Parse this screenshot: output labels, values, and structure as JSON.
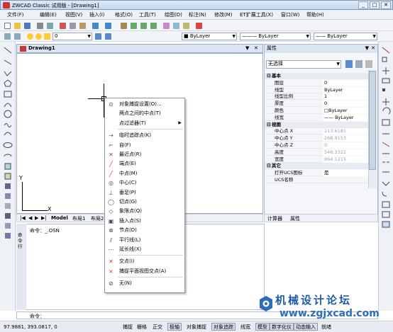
{
  "window": {
    "title": "ZWCAD Classic 试用版 - [Drawing1]"
  },
  "menubar": {
    "items": [
      "文件(F)",
      "编辑(E)",
      "视图(V)",
      "插入(I)",
      "格式(O)",
      "工具(T)",
      "绘图(D)",
      "标注(N)",
      "修改(M)",
      "ET扩展工具(X)",
      "窗口(W)",
      "帮助(H)"
    ]
  },
  "toolbar": {
    "layer_combo": "ByLayer",
    "linetype_combo": "ByLayer",
    "lineweight_combo": "ByLayer",
    "plotstyle_combo": "ByLayer",
    "layer_name": "0"
  },
  "document": {
    "tab_title": "Drawing1"
  },
  "ucs": {
    "x_label": "X",
    "y_label": "Y"
  },
  "layout_tabs": [
    "Model",
    "布局1",
    "布局2"
  ],
  "context_menu": {
    "items": [
      {
        "label": "对象捕捉设置(O)...",
        "icon": "snap-settings-icon"
      },
      {
        "label": "两点之间的中点(T)",
        "icon": "none"
      },
      {
        "label": "点过滤器(T)",
        "icon": "none",
        "submenu": true
      },
      {
        "label": "临时追踪点(K)",
        "icon": "temp-track-icon"
      },
      {
        "label": "自(F)",
        "icon": "from-icon"
      },
      {
        "label": "最近点(R)",
        "icon": "nearest-icon"
      },
      {
        "label": "端点(E)",
        "icon": "endpoint-icon"
      },
      {
        "label": "中点(M)",
        "icon": "midpoint-icon"
      },
      {
        "label": "中心(C)",
        "icon": "center-icon"
      },
      {
        "label": "垂足(P)",
        "icon": "perpendicular-icon"
      },
      {
        "label": "切点(G)",
        "icon": "tangent-icon"
      },
      {
        "label": "象限点(Q)",
        "icon": "quadrant-icon"
      },
      {
        "label": "插入点(S)",
        "icon": "insert-icon"
      },
      {
        "label": "节点(D)",
        "icon": "node-icon"
      },
      {
        "label": "平行线(L)",
        "icon": "parallel-icon"
      },
      {
        "label": "延长线(X)",
        "icon": "extension-icon"
      },
      {
        "label": "交点(I)",
        "icon": "intersection-icon"
      },
      {
        "label": "捕捉平面视图交点(A)",
        "icon": "apparent-intersection-icon"
      },
      {
        "label": "无(N)",
        "icon": "none-snap-icon"
      }
    ]
  },
  "properties": {
    "panel_title": "属性",
    "selection": "无选择",
    "rows": [
      {
        "key": "基本",
        "cat": true
      },
      {
        "key": "图层",
        "value": "0"
      },
      {
        "key": "线型",
        "value": "ByLayer"
      },
      {
        "key": "线型比例",
        "value": "1"
      },
      {
        "key": "厚度",
        "value": "0"
      },
      {
        "key": "颜色",
        "value": "□ByLayer"
      },
      {
        "key": "线宽",
        "value": "—— ByLayer"
      },
      {
        "key": "视图",
        "cat": true
      },
      {
        "key": "中心点 X",
        "value": "213.6181",
        "dim": true
      },
      {
        "key": "中心点 Y",
        "value": "268.9153",
        "dim": true
      },
      {
        "key": "中心点 Z",
        "value": "0",
        "dim": true
      },
      {
        "key": "高度",
        "value": "546.3322",
        "dim": true
      },
      {
        "key": "宽度",
        "value": "864.1215",
        "dim": true
      },
      {
        "key": "其它",
        "cat": true
      },
      {
        "key": "打开UCS图标",
        "value": "是"
      },
      {
        "key": "UCS名称",
        "value": ""
      }
    ],
    "tabs": [
      "计算器",
      "属性"
    ]
  },
  "command": {
    "side_label": "命令行",
    "line1": "命令：_.OSN",
    "line2": "命令："
  },
  "statusbar": {
    "coords": "97.9881,  393.0817,  0",
    "toggles": [
      {
        "label": "捕捉",
        "on": false
      },
      {
        "label": "栅格",
        "on": false
      },
      {
        "label": "正交",
        "on": false
      },
      {
        "label": "极轴",
        "on": true
      },
      {
        "label": "对象捕捉",
        "on": false
      },
      {
        "label": "对象追踪",
        "on": true
      },
      {
        "label": "线宽",
        "on": false
      },
      {
        "label": "模型",
        "on": true
      },
      {
        "label": "数字化仪",
        "on": true
      },
      {
        "label": "动态输入",
        "on": true
      },
      {
        "label": "就绪",
        "on": false
      }
    ]
  },
  "watermark": {
    "text1": "机械设计论坛",
    "text2": "www.zgjxcad.com"
  },
  "colors": {
    "accent": "#1f5aa6",
    "title_bg": "#c7d7ec"
  }
}
